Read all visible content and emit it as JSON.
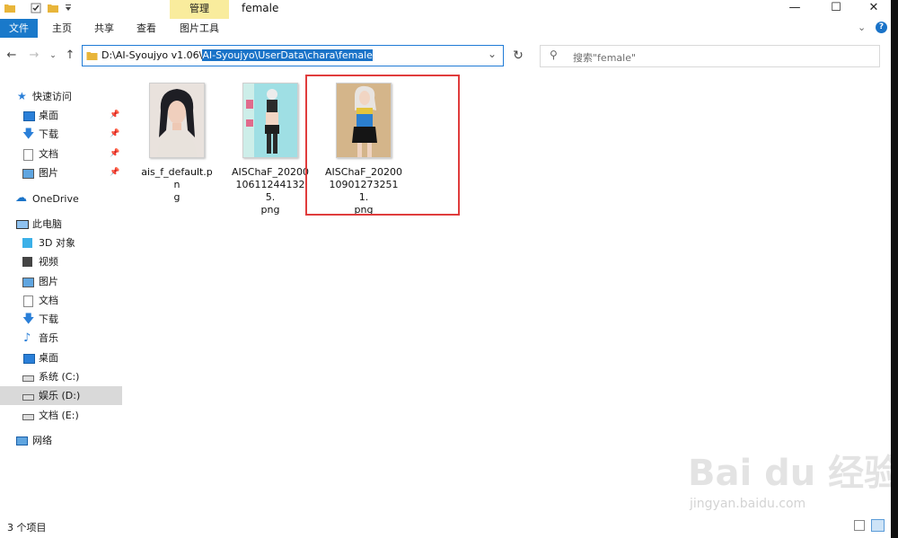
{
  "titlebar": {
    "context_tab": "管理",
    "window_title": "female",
    "controls": [
      "—",
      "☐",
      "✕"
    ]
  },
  "ribbon": {
    "tabs": [
      "文件",
      "主页",
      "共享",
      "查看",
      "图片工具"
    ]
  },
  "address": {
    "path_plain": "D:\\AI-Syoujyo v1.06\\",
    "path_selected": "AI-Syoujyo\\UserData\\chara\\female",
    "dropdown": "⌄",
    "refresh": "↻"
  },
  "search": {
    "placeholder": "搜索\"female\""
  },
  "navpane": {
    "quick_access": "快速访问",
    "quick_items": [
      "桌面",
      "下载",
      "文档",
      "图片"
    ],
    "onedrive": "OneDrive",
    "this_pc": "此电脑",
    "pc_items": [
      "3D 对象",
      "视频",
      "图片",
      "文档",
      "下载",
      "音乐",
      "桌面",
      "系统 (C:)",
      "娱乐 (D:)",
      "文档 (E:)"
    ],
    "network": "网络"
  },
  "files": [
    {
      "name_line1": "ais_f_default.pn",
      "name_line2": "g"
    },
    {
      "name_line1": "AISChaF_20200",
      "name_line2": "106112441325.",
      "name_line3": "png"
    },
    {
      "name_line1": "AISChaF_20200",
      "name_line2": "109012732511.",
      "name_line3": "png"
    }
  ],
  "status": {
    "count": "3 个项目"
  },
  "watermark": {
    "brand": "Bai du 经验",
    "url": "jingyan.baidu.com"
  },
  "colors": {
    "file_tab": "#1979ca",
    "context_tab": "#f9ec9d",
    "highlight_box": "#e03c3c",
    "selection": "#1a73c8"
  }
}
